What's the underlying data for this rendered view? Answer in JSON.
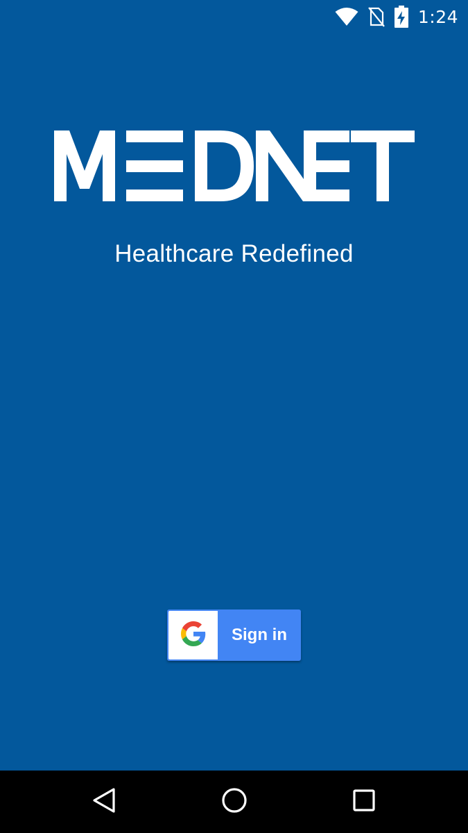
{
  "status_bar": {
    "time": "1:24",
    "icons": [
      "wifi-icon",
      "no-sim-icon",
      "battery-charging-icon"
    ]
  },
  "app": {
    "logo_text": "MEDNET",
    "tagline": "Healthcare Redefined"
  },
  "signin": {
    "label": "Sign in",
    "icon": "google-g-icon",
    "colors": {
      "button": "#4285f4",
      "g_blue": "#4285F4",
      "g_red": "#EA4335",
      "g_yellow": "#FBBC05",
      "g_green": "#34A853"
    }
  },
  "nav_bar": {
    "buttons": [
      "back-icon",
      "home-icon",
      "recents-icon"
    ]
  },
  "colors": {
    "background": "#03589c",
    "nav_bar": "#000000",
    "text": "#ffffff"
  }
}
